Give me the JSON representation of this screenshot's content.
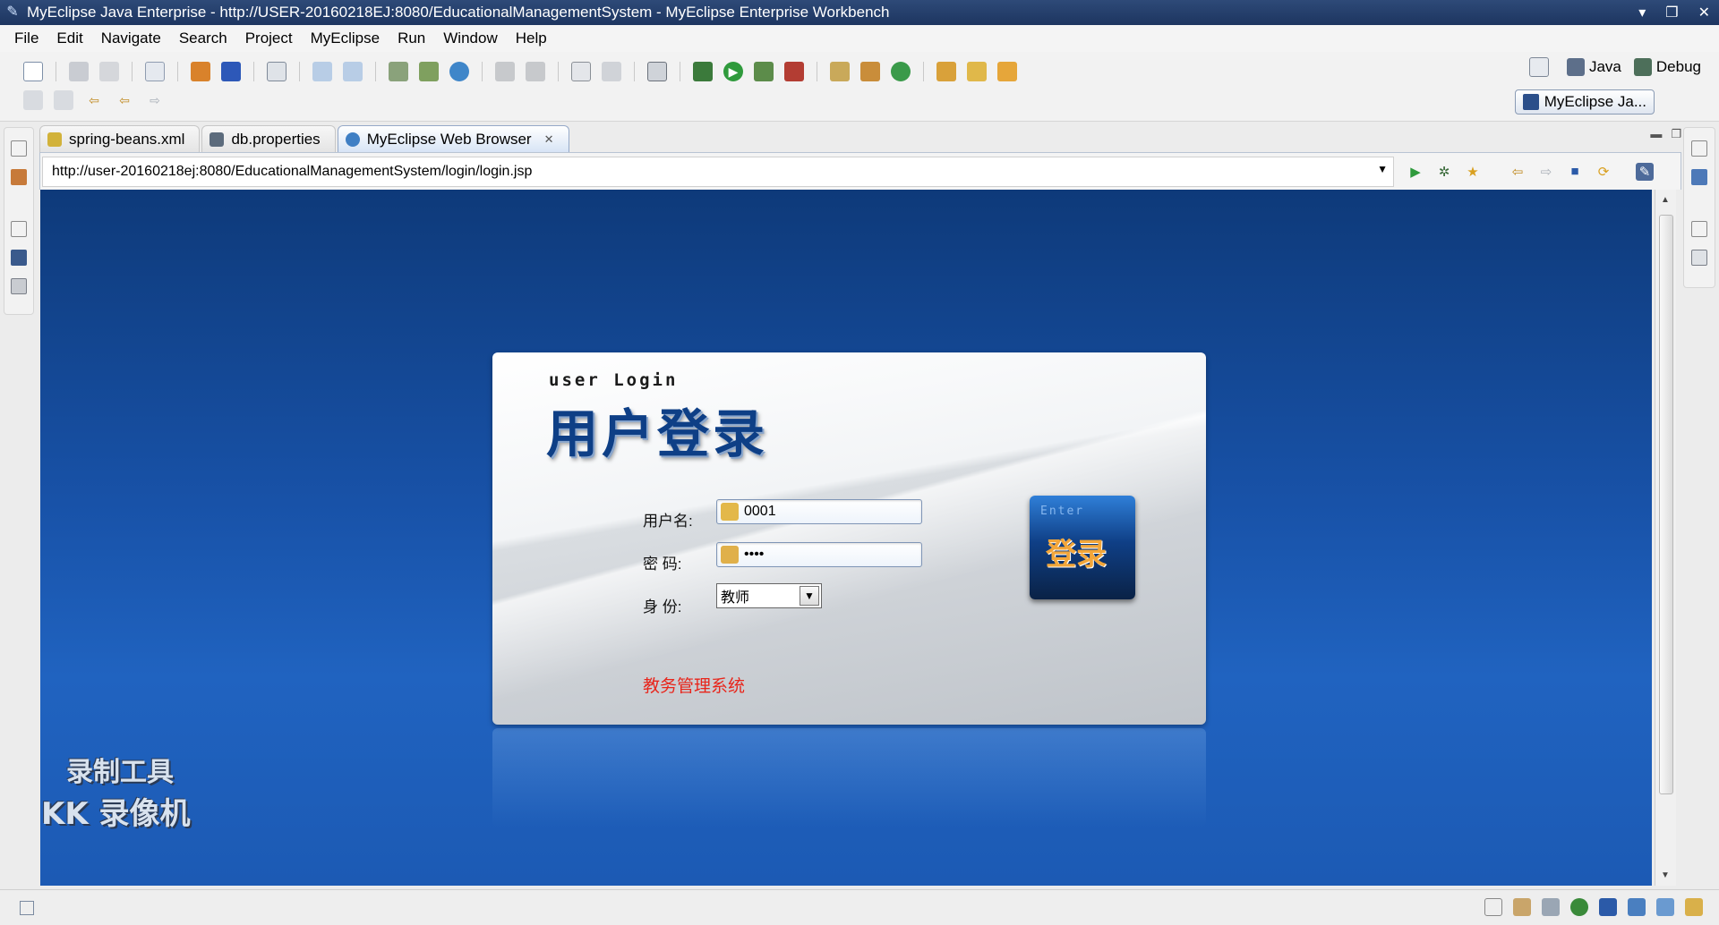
{
  "window": {
    "title": "MyEclipse Java Enterprise - http://USER-20160218EJ:8080/EducationalManagementSystem - MyEclipse Enterprise Workbench",
    "controls": [
      "▾",
      "❐",
      "✕"
    ]
  },
  "menu": [
    "File",
    "Edit",
    "Navigate",
    "Search",
    "Project",
    "MyEclipse",
    "Run",
    "Window",
    "Help"
  ],
  "perspectives": {
    "java": "Java",
    "debug": "Debug",
    "active": "MyEclipse Ja..."
  },
  "tabs": [
    {
      "label": "spring-beans.xml",
      "icon": "xml-file-icon",
      "color": "#d2b23a"
    },
    {
      "label": "db.properties",
      "icon": "properties-file-icon",
      "color": "#5c6b7c"
    },
    {
      "label": "MyEclipse Web Browser",
      "icon": "globe-icon",
      "color": "#3f7fc4",
      "active": true
    }
  ],
  "browser": {
    "url": "http://user-20160218ej:8080/EducationalManagementSystem/login/login.jsp"
  },
  "login": {
    "subtitle": "user Login",
    "title": "用户登录",
    "username_label": "用户名:",
    "username_value": "0001",
    "password_label": "密  码:",
    "password_value": "••••",
    "role_label": "身  份:",
    "role_value": "教师",
    "enter_en": "Enter",
    "enter_zh": "登录",
    "system_name": "教务管理系统"
  },
  "watermark": {
    "line1": "录制工具",
    "line2": "KK 录像机"
  },
  "colors": {
    "titlebar": "#1d3560",
    "browser_bg": "#1852a8",
    "login_title": "#0e3f86",
    "system_name": "#e8251b"
  }
}
